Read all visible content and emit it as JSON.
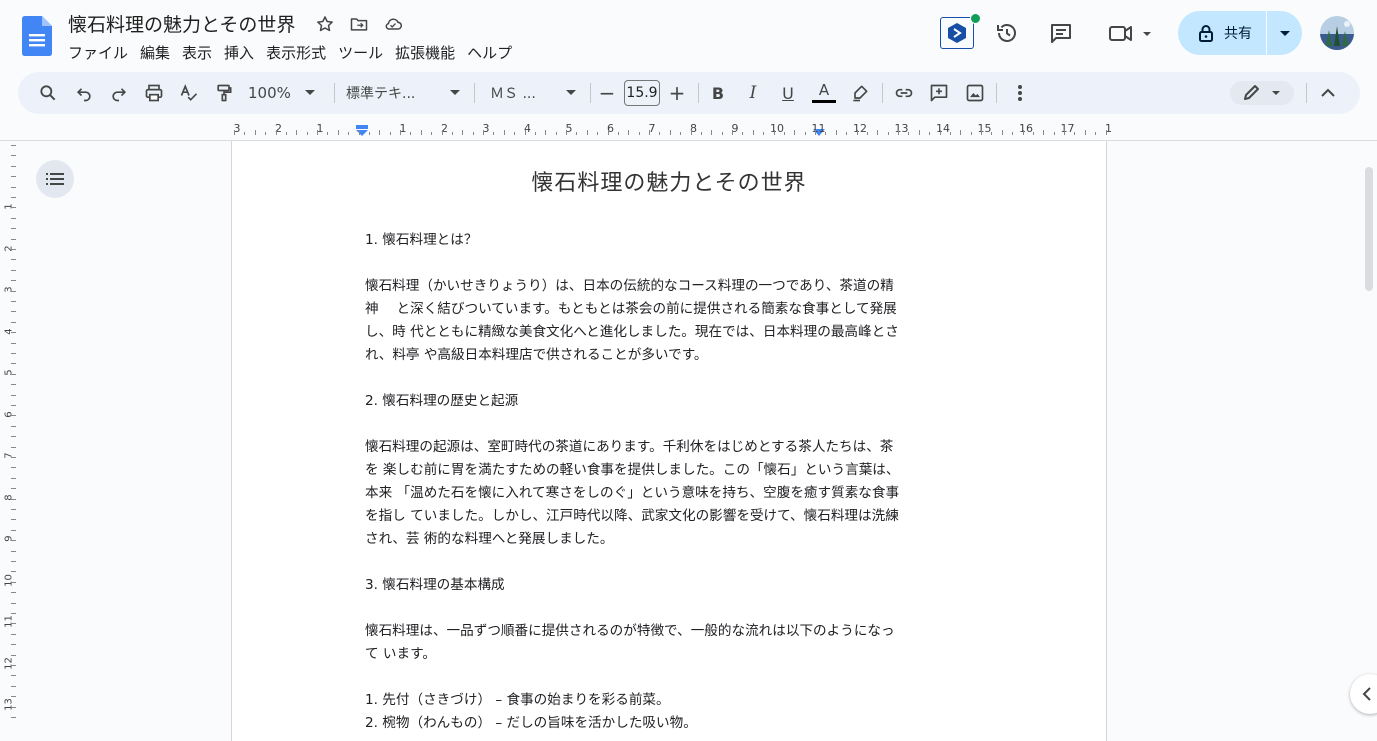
{
  "app": {
    "doc_title": "懐石料理の魅力とその世界",
    "menu": [
      "ファイル",
      "編集",
      "表示",
      "挿入",
      "表示形式",
      "ツール",
      "拡張機能",
      "ヘルプ"
    ],
    "share_label": "共有"
  },
  "toolbar": {
    "zoom": "100%",
    "style": "標準テキ...",
    "font": "ＭＳ ...",
    "font_size": "15.9",
    "minus": "−",
    "plus": "+",
    "bold": "B",
    "italic": "I",
    "underline": "U",
    "text_color": "A"
  },
  "ruler": {
    "numbers": [
      "3",
      "2",
      "1",
      "1",
      "2",
      "3",
      "4",
      "5",
      "6",
      "7",
      "8",
      "9",
      "10",
      "11",
      "12",
      "13",
      "14",
      "15",
      "16",
      "17",
      "1"
    ],
    "vertical_numbers": [
      "1",
      "2",
      "3",
      "4",
      "5",
      "6",
      "7",
      "8",
      "9",
      "10",
      "11",
      "12",
      "13"
    ]
  },
  "document": {
    "title": "懐石料理の魅力とその世界",
    "paragraphs": [
      "1. 懐石料理とは？",
      "",
      "懐石料理（かいせきりょうり）は、日本の伝統的なコース料理の一つであり、茶道の精",
      "神　 と深く結びついています。もともとは茶会の前に提供される簡素な食事として発展",
      "し、時 代とともに精緻な美食文化へと進化しました。現在では、日本料理の最高峰とさ",
      "れ、料亭 や高級日本料理店で供されることが多いです。",
      "",
      "2. 懐石料理の歴史と起源",
      "",
      "懐石料理の起源は、室町時代の茶道にあります。千利休をはじめとする茶人たちは、茶",
      "を 楽しむ前に胃を満たすための軽い食事を提供しました。この「懐石」という言葉は、",
      "本来 「温めた石を懐に入れて寒さをしのぐ」という意味を持ち、空腹を癒す質素な食事",
      "を指し ていました。しかし、江戸時代以降、武家文化の影響を受けて、懐石料理は洗練",
      "され、芸 術的な料理へと発展しました。",
      "",
      "3. 懐石料理の基本構成",
      "",
      "懐石料理は、一品ずつ順番に提供されるのが特徴で、一般的な流れは以下のようになっ",
      "て います。",
      "",
      "1. 先付（さきづけ） – 食事の始まりを彩る前菜。",
      "2. 椀物（わんもの） – だしの旨味を活かした吸い物。"
    ]
  },
  "colors": {
    "share_bg": "#c2e7ff",
    "toolbar_bg": "#edf2fa",
    "accent": "#0b57d0",
    "docs_blue": "#4285f4"
  }
}
